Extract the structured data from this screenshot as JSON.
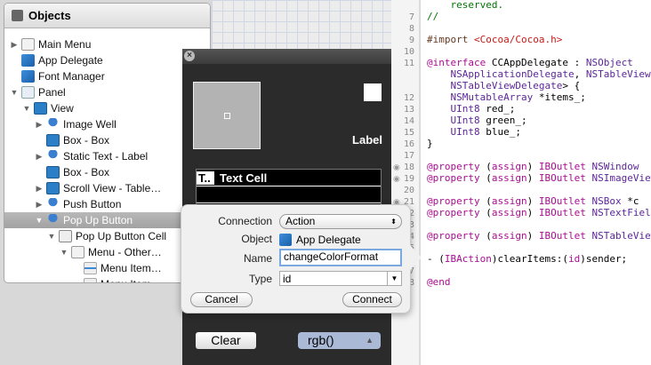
{
  "outline": {
    "title": "Objects",
    "items": [
      {
        "label": "Main Menu",
        "depth": 0,
        "disclosure": "collapsed",
        "icon": "menu"
      },
      {
        "label": "App Delegate",
        "depth": 0,
        "disclosure": "none",
        "icon": "cube"
      },
      {
        "label": "Font Manager",
        "depth": 0,
        "disclosure": "none",
        "icon": "cube"
      },
      {
        "label": "Panel",
        "depth": 0,
        "disclosure": "expanded",
        "icon": "win"
      },
      {
        "label": "View",
        "depth": 1,
        "disclosure": "expanded",
        "icon": "view"
      },
      {
        "label": "Image Well",
        "depth": 2,
        "disclosure": "collapsed",
        "icon": "ctl"
      },
      {
        "label": "Box - Box",
        "depth": 2,
        "disclosure": "none",
        "icon": "view"
      },
      {
        "label": "Static Text - Label",
        "depth": 2,
        "disclosure": "collapsed",
        "icon": "ctl"
      },
      {
        "label": "Box - Box",
        "depth": 2,
        "disclosure": "none",
        "icon": "view"
      },
      {
        "label": "Scroll View - Table…",
        "depth": 2,
        "disclosure": "collapsed",
        "icon": "view"
      },
      {
        "label": "Push Button",
        "depth": 2,
        "disclosure": "collapsed",
        "icon": "ctl"
      },
      {
        "label": "Pop Up Button",
        "depth": 2,
        "disclosure": "expanded",
        "icon": "ctl",
        "selected": true
      },
      {
        "label": "Pop Up Button Cell",
        "depth": 3,
        "disclosure": "expanded",
        "icon": "cell"
      },
      {
        "label": "Menu - Other…",
        "depth": 4,
        "disclosure": "expanded",
        "icon": "menu"
      },
      {
        "label": "Menu Item…",
        "depth": 5,
        "disclosure": "none",
        "icon": "item"
      },
      {
        "label": "Menu Item…",
        "depth": 5,
        "disclosure": "none",
        "icon": "item"
      }
    ]
  },
  "panel": {
    "label": "Label",
    "table_header_trunc": "T..",
    "table_header": "Text Cell",
    "clear_button": "Clear",
    "popup_value": "rgb()"
  },
  "popover": {
    "connection_label": "Connection",
    "connection_value": "Action",
    "object_label": "Object",
    "object_value": "App Delegate",
    "name_label": "Name",
    "name_value": "changeColorFormat",
    "type_label": "Type",
    "type_value": "id",
    "cancel": "Cancel",
    "connect": "Connect"
  },
  "editor": {
    "lines": [
      {
        "n": "",
        "text": "    reserved.",
        "cls": "cm",
        "partial": true
      },
      {
        "n": "7",
        "text": "//",
        "cls": "cm"
      },
      {
        "n": "8",
        "text": ""
      },
      {
        "n": "9",
        "parts": [
          [
            "#import ",
            "pp"
          ],
          [
            "<Cocoa/Cocoa.h>",
            "str"
          ]
        ]
      },
      {
        "n": "10",
        "text": ""
      },
      {
        "n": "11",
        "parts": [
          [
            "@interface",
            "kw"
          ],
          [
            " CCAppDelegate : ",
            ""
          ],
          [
            "NSObject",
            "ty"
          ]
        ]
      },
      {
        "n": "",
        "parts": [
          [
            "    NSApplicationDelegate",
            "ty"
          ],
          [
            ", ",
            ""
          ],
          [
            "NSTableViewDataSource",
            "ty"
          ]
        ]
      },
      {
        "n": "",
        "parts": [
          [
            "    NSTableViewDelegate",
            "ty"
          ],
          [
            "> {",
            ""
          ]
        ]
      },
      {
        "n": "12",
        "parts": [
          [
            "    NSMutableArray",
            "ty"
          ],
          [
            " *items_;",
            ""
          ]
        ]
      },
      {
        "n": "13",
        "parts": [
          [
            "    UInt8",
            "ty"
          ],
          [
            " red_;",
            ""
          ]
        ]
      },
      {
        "n": "14",
        "parts": [
          [
            "    UInt8",
            "ty"
          ],
          [
            " green_;",
            ""
          ]
        ]
      },
      {
        "n": "15",
        "parts": [
          [
            "    UInt8",
            "ty"
          ],
          [
            " blue_;",
            ""
          ]
        ]
      },
      {
        "n": "16",
        "text": "}"
      },
      {
        "n": "17",
        "text": ""
      },
      {
        "n": "18",
        "bp": true,
        "parts": [
          [
            "@property",
            "kw"
          ],
          [
            " (",
            ""
          ],
          [
            "assign",
            "kw"
          ],
          [
            ") ",
            ""
          ],
          [
            "IBOutlet",
            "kw"
          ],
          [
            " NSWindow",
            "ty"
          ]
        ]
      },
      {
        "n": "19",
        "bp": true,
        "parts": [
          [
            "@property",
            "kw"
          ],
          [
            " (",
            ""
          ],
          [
            "assign",
            "kw"
          ],
          [
            ") ",
            ""
          ],
          [
            "IBOutlet",
            "kw"
          ],
          [
            " NSImageView",
            "ty"
          ]
        ]
      },
      {
        "n": "20",
        "text": ""
      },
      {
        "n": "21",
        "bp": true,
        "parts": [
          [
            "@property",
            "kw"
          ],
          [
            " (",
            ""
          ],
          [
            "assign",
            "kw"
          ],
          [
            ") ",
            ""
          ],
          [
            "IBOutlet",
            "kw"
          ],
          [
            " NSBox",
            "ty"
          ],
          [
            " *c",
            ""
          ]
        ]
      },
      {
        "n": "22",
        "bp": true,
        "parts": [
          [
            "@property",
            "kw"
          ],
          [
            " (",
            ""
          ],
          [
            "assign",
            "kw"
          ],
          [
            ") ",
            ""
          ],
          [
            "IBOutlet",
            "kw"
          ],
          [
            " NSTextField",
            "ty"
          ]
        ]
      },
      {
        "n": "23",
        "text": ""
      },
      {
        "n": "24",
        "parts": [
          [
            "@property",
            "kw"
          ],
          [
            " (",
            ""
          ],
          [
            "assign",
            "kw"
          ],
          [
            ") ",
            ""
          ],
          [
            "IBOutlet",
            "kw"
          ],
          [
            " NSTableView",
            "ty"
          ]
        ]
      },
      {
        "n": "25",
        "text": ""
      },
      {
        "n": "26",
        "parts": [
          [
            "- (",
            ""
          ],
          [
            "IBAction",
            "kw"
          ],
          [
            ")clearItems:(",
            ""
          ],
          [
            "id",
            "kw"
          ],
          [
            ")sender;",
            ""
          ]
        ]
      },
      {
        "n": "27",
        "text": ""
      },
      {
        "n": "28",
        "parts": [
          [
            "@end",
            "kw"
          ]
        ]
      }
    ]
  }
}
